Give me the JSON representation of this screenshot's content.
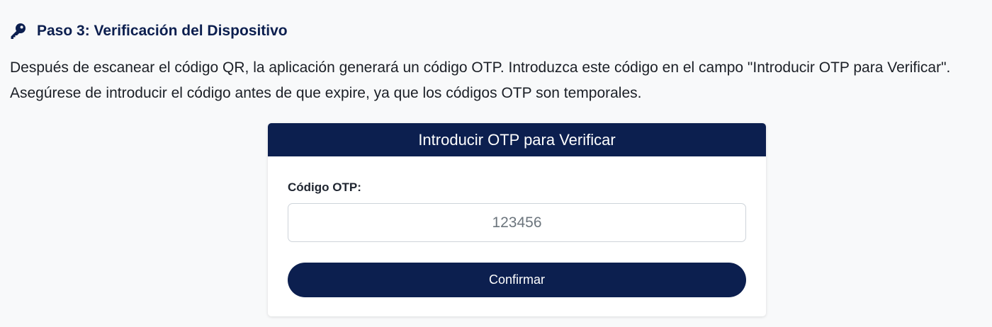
{
  "step": {
    "icon": "key-icon",
    "title": "Paso 3: Verificación del Dispositivo",
    "description": "Después de escanear el código QR, la aplicación generará un código OTP. Introduzca este código en el campo \"Introducir OTP para Verificar\". Asegúrese de introducir el código antes de que expire, ya que los códigos OTP son temporales."
  },
  "otp_card": {
    "header": "Introducir OTP para Verificar",
    "label": "Código OTP:",
    "input_value": "",
    "input_placeholder": "123456",
    "button_label": "Confirmar"
  },
  "colors": {
    "brand_navy": "#0c1f4f",
    "page_background": "#f8f9fa",
    "card_background": "#ffffff"
  }
}
